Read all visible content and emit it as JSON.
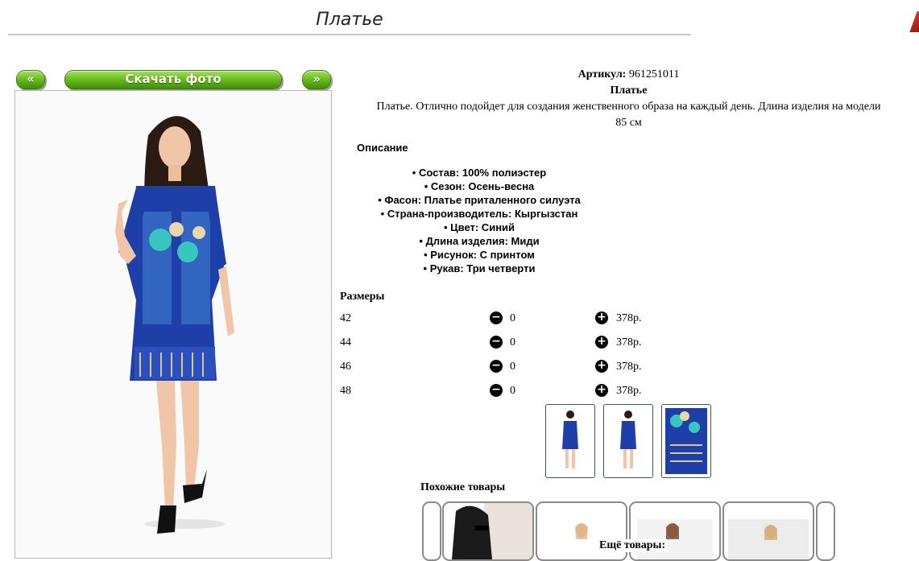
{
  "page_title": "Платье",
  "nav": {
    "prev_label": "«",
    "download_label": "Скачать фото",
    "next_label": "»"
  },
  "product": {
    "article_label": "Артикул:",
    "article_value": "961251011",
    "name": "Платье",
    "description_line1": "Платье. Отлично подойдет для создания женственного образа на каждый день. Длина изделия на модели",
    "description_line2": "85 см"
  },
  "details": {
    "title": "Описание",
    "items": [
      "Состав: 100% полиэстер",
      "Сезон: Осень-весна",
      "Фасон: Платье приталенного силуэта",
      "Страна-производитель: Кыргызстан",
      "Цвет: Синий",
      "Длина изделия: Миди",
      "Рисунок: С принтом",
      "Рукав: Три четверти"
    ]
  },
  "sizes": {
    "title": "Размеры",
    "rows": [
      {
        "size": "42",
        "qty": "0",
        "price": "378р."
      },
      {
        "size": "44",
        "qty": "0",
        "price": "378р."
      },
      {
        "size": "46",
        "qty": "0",
        "price": "378р."
      },
      {
        "size": "48",
        "qty": "0",
        "price": "378р."
      }
    ]
  },
  "similar": {
    "title": "Похожие товары"
  },
  "more": {
    "title": "Ещё товары:"
  },
  "icons": {
    "minus": "minus-circle-icon",
    "plus": "plus-circle-icon"
  },
  "colors": {
    "accent_green": "#6cbf1c",
    "dress_blue": "#1f3fa8",
    "divider": "#c8c8c8"
  }
}
